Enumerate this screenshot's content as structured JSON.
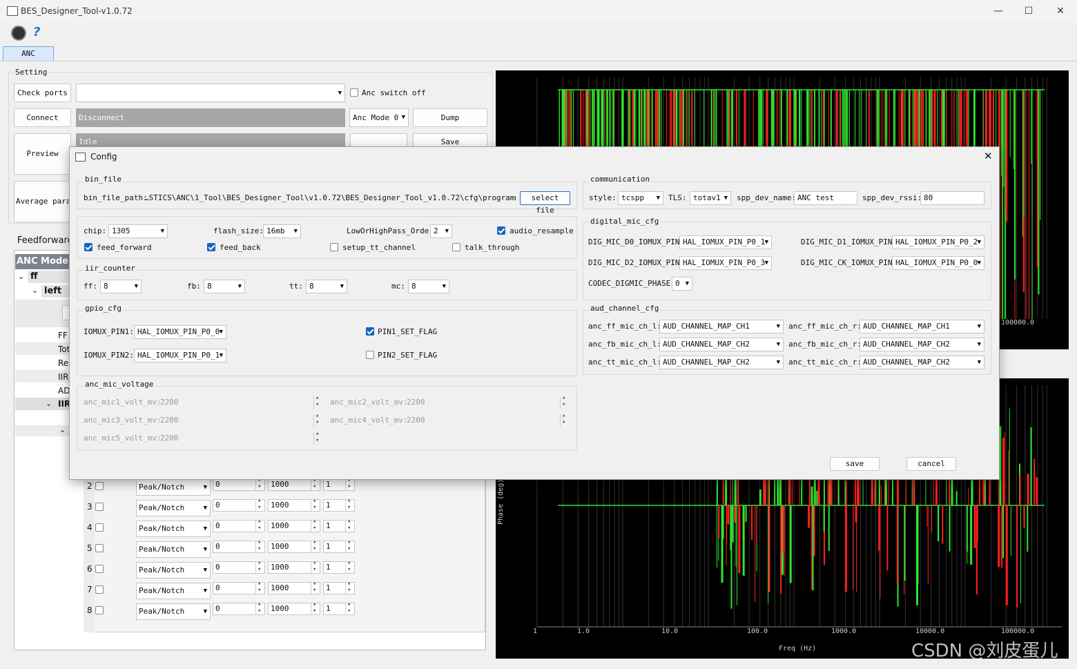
{
  "window": {
    "title": "BES_Designer_Tool-v1.0.72"
  },
  "tabs": [
    {
      "label": "ANC"
    }
  ],
  "setting": {
    "group_title": "Setting",
    "check_ports": "Check ports",
    "anc_switch_off": "Anc switch off",
    "connect": "Connect",
    "disconnect": "Disconnect",
    "anc_mode": "Anc Mode 0",
    "dump": "Dump",
    "preview": "Preview",
    "idle": "Idle",
    "save": "Save",
    "average_param": "Average param"
  },
  "left_panel": {
    "feedforward": "Feedforward",
    "tree_header": "ANC Mode",
    "tree_ff": "ff",
    "tree_left": "left",
    "tree_items": [
      "FF",
      "Tot",
      "Re",
      "IIR",
      "AD",
      "IIR"
    ]
  },
  "filter_rows": [
    {
      "n": "2",
      "type": "Peak/Notch",
      "gain": "0",
      "freq": "1000",
      "q": "1"
    },
    {
      "n": "3",
      "type": "Peak/Notch",
      "gain": "0",
      "freq": "1000",
      "q": "1"
    },
    {
      "n": "4",
      "type": "Peak/Notch",
      "gain": "0",
      "freq": "1000",
      "q": "1"
    },
    {
      "n": "5",
      "type": "Peak/Notch",
      "gain": "0",
      "freq": "1000",
      "q": "1"
    },
    {
      "n": "6",
      "type": "Peak/Notch",
      "gain": "0",
      "freq": "1000",
      "q": "1"
    },
    {
      "n": "7",
      "type": "Peak/Notch",
      "gain": "0",
      "freq": "1000",
      "q": "1"
    },
    {
      "n": "8",
      "type": "Peak/Notch",
      "gain": "0",
      "freq": "1000",
      "q": "1"
    }
  ],
  "plots": {
    "top_tick_visible": "100000.0",
    "bottom_ylabel": "Phase (deg)",
    "bottom_xlabel": "Freq (Hz)",
    "x_ticks": [
      "1",
      "1.0",
      "10.0",
      "100.0",
      "1000.0",
      "10000.0",
      "100000.0"
    ]
  },
  "watermark": "CSDN @刘皮蛋儿",
  "dialog": {
    "title": "Config",
    "bin_file": {
      "title": "bin_file",
      "path_label": "bin_file_path:",
      "path_value": "…STICS\\ANC\\1_Tool\\BES_Designer_Tool\\v1.0.72\\BES_Designer_Tool_v1.0.72\\cfg\\programmer.bin",
      "select_file": "select file"
    },
    "chip_row": {
      "chip_label": "chip:",
      "chip_value": "1305",
      "flash_label": "flash_size:",
      "flash_value": "16mb",
      "order_label": "LowOrHighPass_Order",
      "order_value": "2",
      "audio_resample": "audio_resample",
      "feed_forward": "feed_forward",
      "feed_back": "feed_back",
      "setup_tt_channel": "setup_tt_channel",
      "talk_through": "talk_through"
    },
    "iir_counter": {
      "title": "iir_counter",
      "ff_label": "ff:",
      "ff_value": "8",
      "fb_label": "fb:",
      "fb_value": "8",
      "tt_label": "tt:",
      "tt_value": "8",
      "mc_label": "mc:",
      "mc_value": "8"
    },
    "gpio_cfg": {
      "title": "gpio_cfg",
      "pin1_label": "IOMUX_PIN1:",
      "pin1_value": "HAL_IOMUX_PIN_P0_0",
      "pin2_label": "IOMUX_PIN2:",
      "pin2_value": "HAL_IOMUX_PIN_P0_1",
      "pin1_flag": "PIN1_SET_FLAG",
      "pin2_flag": "PIN2_SET_FLAG"
    },
    "anc_mic_voltage": {
      "title": "anc_mic_voltage",
      "mic1_label": "anc_mic1_volt_mv:",
      "mic1_value": "2200",
      "mic2_label": "anc_mic2_volt_mv:",
      "mic2_value": "2200",
      "mic3_label": "anc_mic3_volt_mv:",
      "mic3_value": "2200",
      "mic4_label": "anc_mic4_volt_mv:",
      "mic4_value": "2200",
      "mic5_label": "anc_mic5_volt_mv:",
      "mic5_value": "2200"
    },
    "communication": {
      "title": "communication",
      "style_label": "style:",
      "style_value": "tcspp",
      "tls_label": "TLS:",
      "tls_value": "totav1",
      "spp_name_label": "spp_dev_name:",
      "spp_name_value": "ANC test",
      "spp_rssi_label": "spp_dev_rssi:",
      "spp_rssi_value": "80"
    },
    "digital_mic_cfg": {
      "title": "digital_mic_cfg",
      "d0_label": "DIG_MIC_D0_IOMUX_PIN:",
      "d0_value": "HAL_IOMUX_PIN_P0_1",
      "d1_label": "DIG_MIC_D1_IOMUX_PIN:",
      "d1_value": "HAL_IOMUX_PIN_P0_2",
      "d2_label": "DIG_MIC_D2_IOMUX_PIN:",
      "d2_value": "HAL_IOMUX_PIN_P0_3",
      "ck_label": "DIG_MIC_CK_IOMUX_PIN:",
      "ck_value": "HAL_IOMUX_PIN_P0_0",
      "phase_label": "CODEC_DIGMIC_PHASE:",
      "phase_value": "0"
    },
    "aud_channel_cfg": {
      "title": "aud_channel_cfg",
      "ff_l_label": "anc_ff_mic_ch_l:",
      "ff_l_value": "AUD_CHANNEL_MAP_CH1",
      "ff_r_label": "anc_ff_mic_ch_r:",
      "ff_r_value": "AUD_CHANNEL_MAP_CH1",
      "fb_l_label": "anc_fb_mic_ch_l:",
      "fb_l_value": "AUD_CHANNEL_MAP_CH2",
      "fb_r_label": "anc_fb_mic_ch_r:",
      "fb_r_value": "AUD_CHANNEL_MAP_CH2",
      "tt_l_label": "anc_tt_mic_ch_l:",
      "tt_l_value": "AUD_CHANNEL_MAP_CH2",
      "tt_r_label": "anc_tt_mic_ch_r:",
      "tt_r_value": "AUD_CHANNEL_MAP_CH2"
    },
    "save": "save",
    "cancel": "cancel"
  }
}
